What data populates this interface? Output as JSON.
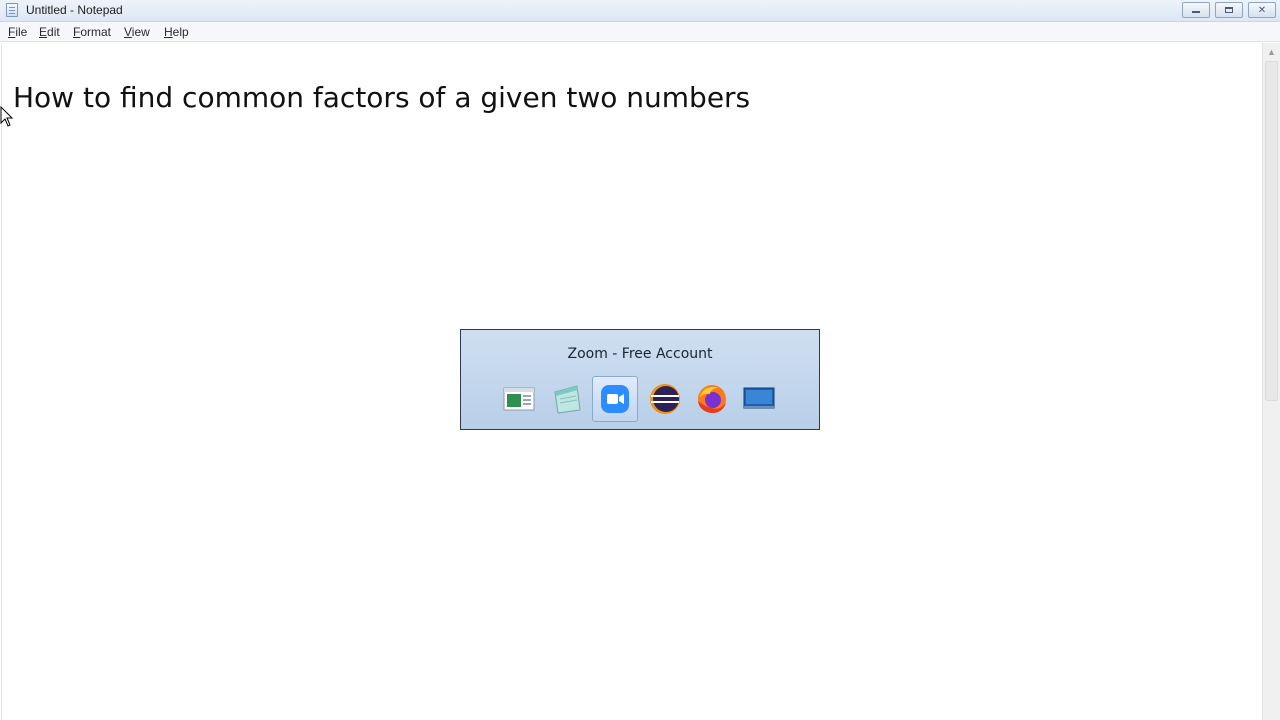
{
  "window": {
    "title": "Untitled - Notepad"
  },
  "menu": {
    "items": [
      {
        "key": "F",
        "rest": "ile"
      },
      {
        "key": "E",
        "rest": "dit"
      },
      {
        "key": "F",
        "rest": "ormat"
      },
      {
        "key": "V",
        "rest": "iew"
      },
      {
        "key": "H",
        "rest": "elp"
      }
    ]
  },
  "editor": {
    "content": "How to find common factors of a given two numbers"
  },
  "switcher": {
    "title": "Zoom - Free Account",
    "apps": [
      {
        "icon": "document-app-icon",
        "selected": false
      },
      {
        "icon": "notepad-app-icon",
        "selected": false
      },
      {
        "icon": "zoom-app-icon",
        "selected": true
      },
      {
        "icon": "eclipse-app-icon",
        "selected": false
      },
      {
        "icon": "firefox-app-icon",
        "selected": false
      },
      {
        "icon": "desktop-app-icon",
        "selected": false
      }
    ]
  },
  "colors": {
    "titlebar": "#dde7f3",
    "switcher_bg": "#c4d8ee",
    "zoom_blue": "#2d8cff",
    "firefox_orange": "#ff7a1a",
    "eclipse_purple": "#2c2255"
  }
}
